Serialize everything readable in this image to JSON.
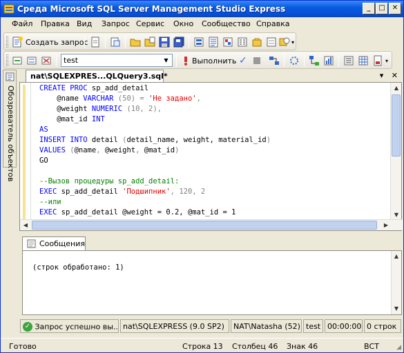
{
  "window": {
    "title": "Среда Microsoft SQL Server Management Studio Express",
    "controls": {
      "minimize": "_",
      "maximize": "□",
      "close": "✕"
    }
  },
  "menu": [
    "Файл",
    "Правка",
    "Вид",
    "Запрос",
    "Сервис",
    "Окно",
    "Сообщество",
    "Справка"
  ],
  "toolbar1": {
    "new_query_label": "Создать запрос"
  },
  "toolbar2": {
    "database_value": "test",
    "execute_label": "Выполнить"
  },
  "sidepanel": {
    "label": "Обозреватель объектов"
  },
  "document": {
    "tab_title": "nat\\SQLEXPRES...QLQuery3.sql*",
    "dropdown": "▾",
    "close": "✕"
  },
  "code": {
    "lines": [
      [
        {
          "t": "CREATE PROC",
          "c": "kw"
        },
        {
          "t": " sp_add_detail",
          "c": ""
        }
      ],
      [
        {
          "t": "    @name ",
          "c": ""
        },
        {
          "t": "VARCHAR",
          "c": "kw"
        },
        {
          "t": " (50) = ",
          "c": "gy"
        },
        {
          "t": "'Не задано'",
          "c": "str"
        },
        {
          "t": ",",
          "c": "gy"
        }
      ],
      [
        {
          "t": "    @weight ",
          "c": ""
        },
        {
          "t": "NUMERIC",
          "c": "kw"
        },
        {
          "t": " (10, 2),",
          "c": "gy"
        }
      ],
      [
        {
          "t": "    @mat_id ",
          "c": ""
        },
        {
          "t": "INT",
          "c": "kw"
        }
      ],
      [
        {
          "t": "AS",
          "c": "kw"
        }
      ],
      [
        {
          "t": "INSERT INTO",
          "c": "kw"
        },
        {
          "t": " detail ",
          "c": ""
        },
        {
          "t": "(",
          "c": "gy"
        },
        {
          "t": "detail_name, weight, material_id",
          "c": ""
        },
        {
          "t": ")",
          "c": "gy"
        }
      ],
      [
        {
          "t": "VALUES",
          "c": "kw"
        },
        {
          "t": " (",
          "c": "gy"
        },
        {
          "t": "@name",
          "c": ""
        },
        {
          "t": ", ",
          "c": "gy"
        },
        {
          "t": "@weight",
          "c": ""
        },
        {
          "t": ", ",
          "c": "gy"
        },
        {
          "t": "@mat_id",
          "c": ""
        },
        {
          "t": ")",
          "c": "gy"
        }
      ],
      [
        {
          "t": "GO",
          "c": ""
        }
      ],
      [
        {
          "t": "",
          "c": ""
        }
      ],
      [
        {
          "t": "--Вызов процедуры sp_add_detail:",
          "c": "cm"
        }
      ],
      [
        {
          "t": "EXEC",
          "c": "kw"
        },
        {
          "t": " sp_add_detail ",
          "c": ""
        },
        {
          "t": "'Подшипник'",
          "c": "str"
        },
        {
          "t": ", 120, 2",
          "c": "gy"
        }
      ],
      [
        {
          "t": "--или",
          "c": "cm"
        }
      ],
      [
        {
          "t": "EXEC",
          "c": "kw"
        },
        {
          "t": " sp_add_detail ",
          "c": ""
        },
        {
          "t": "@weight = 0.2, @mat_id = 1",
          "c": ""
        }
      ]
    ]
  },
  "messages": {
    "tab_label": "Сообщения",
    "text": "(строк обработано: 1)"
  },
  "query_status": {
    "result": "Запрос успешно вы...",
    "server": "nat\\SQLEXPRESS (9.0 SP2)",
    "user": "NAT\\Natasha (52)",
    "database": "test",
    "elapsed": "00:00:00",
    "rows": "0 строк"
  },
  "app_status": {
    "ready": "Готово",
    "row": "Строка 13",
    "col": "Столбец 46",
    "ch": "Знак 46",
    "mode": "ВСТ"
  },
  "colors": {
    "keyword": "#0000ff",
    "string": "#e00000",
    "comment": "#008000",
    "titlebar": "#0a5ae0"
  }
}
